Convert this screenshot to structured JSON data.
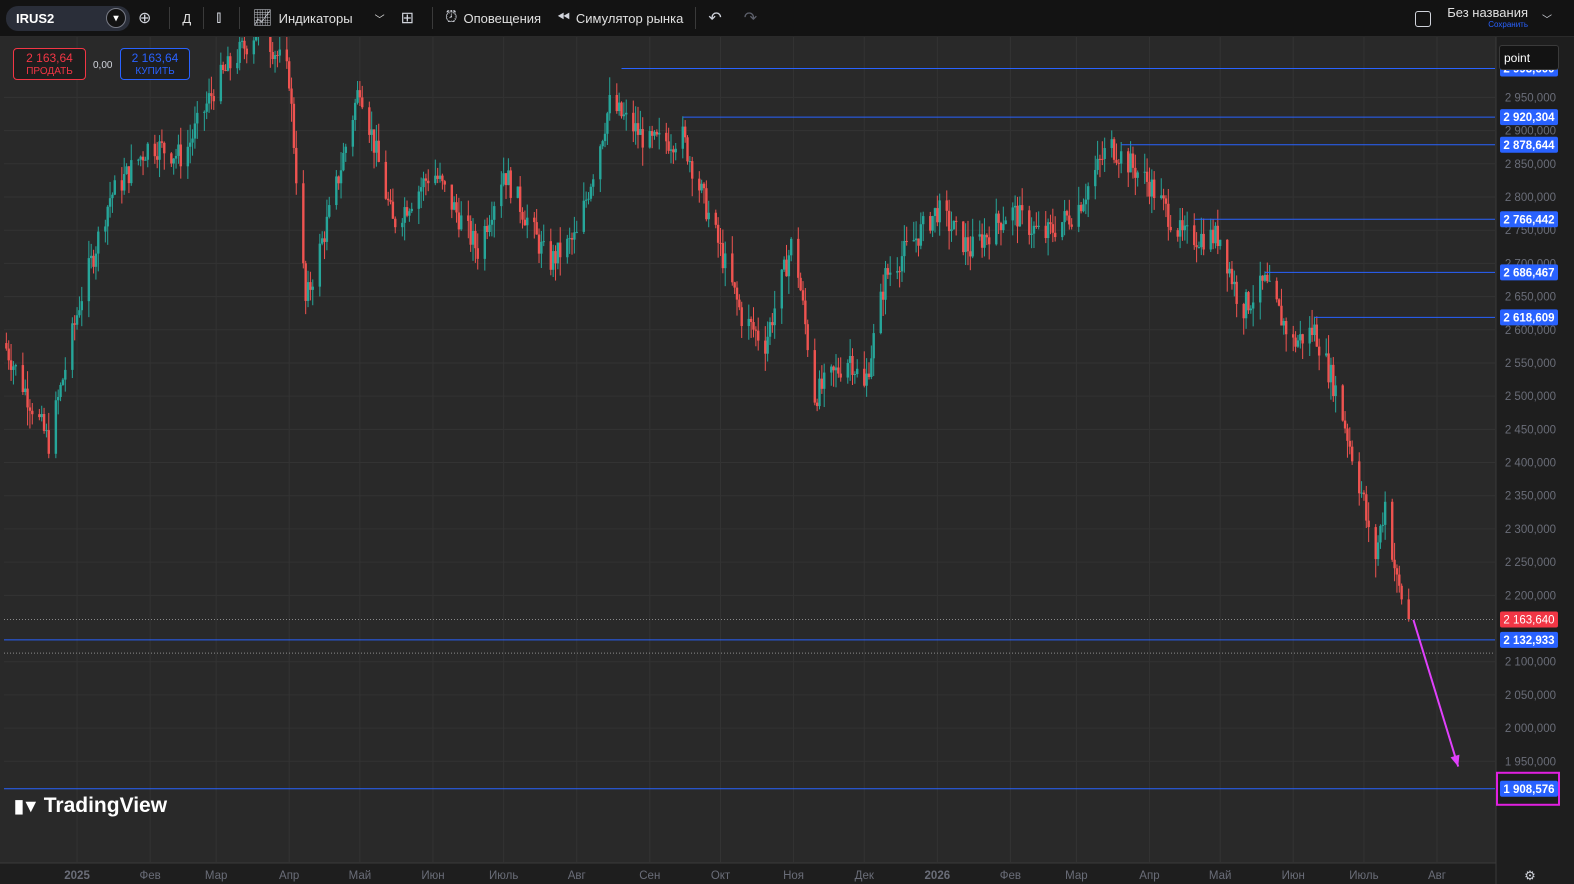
{
  "toolbar": {
    "symbol": "IRUS2",
    "interval": "Д",
    "indicators": "Индикаторы",
    "alerts": "Оповещения",
    "replay": "Симулятор рынка",
    "layout_name": "Без названия",
    "save": "Сохранить"
  },
  "trade": {
    "sell_price": "2 163,64",
    "sell_label": "ПРОДАТЬ",
    "buy_price": "2 163,64",
    "buy_label": "КУПИТЬ",
    "spread": "0,00"
  },
  "scale_input": "point",
  "watermark": "TradingView",
  "colors": {
    "background": "#292929",
    "up": "#26a69a",
    "down": "#ef5350",
    "level_line": "#2962ff",
    "arrow": "#e040fb",
    "last_price": "#f23645"
  },
  "chart_data": {
    "type": "candlestick",
    "ylim": [
      1850,
      3060
    ],
    "y_ticks": [
      "2 950,000",
      "2 900,000",
      "2 850,000",
      "2 800,000",
      "2 750,000",
      "2 700,000",
      "2 650,000",
      "2 600,000",
      "2 550,000",
      "2 500,000",
      "2 450,000",
      "2 400,000",
      "2 350,000",
      "2 300,000",
      "2 250,000",
      "2 200,000",
      "2 100,000",
      "2 050,000",
      "2 000,000",
      "1 950,000"
    ],
    "y_tick_values": [
      2950,
      2900,
      2850,
      2800,
      2750,
      2700,
      2650,
      2600,
      2550,
      2500,
      2450,
      2400,
      2350,
      2300,
      2250,
      2200,
      2100,
      2050,
      2000,
      1950
    ],
    "x_labels": [
      "2025",
      "Фев",
      "Мар",
      "Апр",
      "Май",
      "Июн",
      "Июль",
      "Авг",
      "Сен",
      "Окт",
      "Ноя",
      "Дек",
      "2026",
      "Фев",
      "Мар",
      "Апр",
      "Май",
      "Июн",
      "Июль",
      "Авг"
    ],
    "x_label_dates": [
      "2025-01-01",
      "2025-02-01",
      "2025-03-01",
      "2025-04-01",
      "2025-05-01",
      "2025-06-01",
      "2025-07-01",
      "2025-08-01",
      "2025-09-01",
      "2025-10-01",
      "2025-11-01",
      "2025-12-01",
      "2026-01-01",
      "2026-02-01",
      "2026-03-01",
      "2026-04-01",
      "2026-05-01",
      "2026-06-01",
      "2026-07-01",
      "2026-08-01"
    ],
    "x_range": [
      "2024-12-01",
      "2026-08-15"
    ],
    "price_path": [
      [
        "2024-12-01",
        2580
      ],
      [
        "2024-12-20",
        2430
      ],
      [
        "2025-01-02",
        2640
      ],
      [
        "2025-01-15",
        2800
      ],
      [
        "2025-02-01",
        2880
      ],
      [
        "2025-02-15",
        2860
      ],
      [
        "2025-03-01",
        2970
      ],
      [
        "2025-03-20",
        3060
      ],
      [
        "2025-04-01",
        2980
      ],
      [
        "2025-04-08",
        2640
      ],
      [
        "2025-04-20",
        2800
      ],
      [
        "2025-05-01",
        2970
      ],
      [
        "2025-05-15",
        2760
      ],
      [
        "2025-06-01",
        2840
      ],
      [
        "2025-06-20",
        2720
      ],
      [
        "2025-07-01",
        2840
      ],
      [
        "2025-07-20",
        2700
      ],
      [
        "2025-08-01",
        2740
      ],
      [
        "2025-08-15",
        2940
      ],
      [
        "2025-09-01",
        2880
      ],
      [
        "2025-09-15",
        2890
      ],
      [
        "2025-10-01",
        2720
      ],
      [
        "2025-10-10",
        2620
      ],
      [
        "2025-10-20",
        2580
      ],
      [
        "2025-11-01",
        2740
      ],
      [
        "2025-11-10",
        2500
      ],
      [
        "2025-11-25",
        2560
      ],
      [
        "2025-12-01",
        2510
      ],
      [
        "2025-12-10",
        2680
      ],
      [
        "2026-01-01",
        2780
      ],
      [
        "2026-01-15",
        2720
      ],
      [
        "2026-02-01",
        2780
      ],
      [
        "2026-02-15",
        2740
      ],
      [
        "2026-03-01",
        2780
      ],
      [
        "2026-03-15",
        2880
      ],
      [
        "2026-04-01",
        2820
      ],
      [
        "2026-04-15",
        2740
      ],
      [
        "2026-05-01",
        2740
      ],
      [
        "2026-05-10",
        2630
      ],
      [
        "2026-05-20",
        2670
      ],
      [
        "2026-06-01",
        2580
      ],
      [
        "2026-06-10",
        2600
      ],
      [
        "2026-06-20",
        2500
      ],
      [
        "2026-07-01",
        2340
      ],
      [
        "2026-07-05",
        2240
      ],
      [
        "2026-07-10",
        2340
      ],
      [
        "2026-07-15",
        2220
      ],
      [
        "2026-07-20",
        2163
      ]
    ],
    "levels": [
      {
        "price": 2993.6,
        "label": "2 993,600",
        "from": "2025-08-20"
      },
      {
        "price": 2920.304,
        "label": "2 920,304",
        "from": "2025-09-15"
      },
      {
        "price": 2878.644,
        "label": "2 878,644",
        "from": "2026-03-20"
      },
      {
        "price": 2766.442,
        "label": "2 766,442",
        "from": "2026-04-20"
      },
      {
        "price": 2686.467,
        "label": "2 686,467",
        "from": "2026-05-20"
      },
      {
        "price": 2618.609,
        "label": "2 618,609",
        "from": "2026-06-10"
      },
      {
        "price": 2132.933,
        "label": "2 132,933",
        "from": "2024-12-01"
      },
      {
        "price": 1908.576,
        "label": "1 908,576",
        "from": "2024-12-01",
        "highlighted": true
      }
    ],
    "last_price": {
      "price": 2163.64,
      "label": "2 163,640"
    },
    "dotted_lines": [
      2163.64,
      2113
    ],
    "arrow": {
      "from": [
        "2026-07-22",
        2163
      ],
      "to": [
        "2026-08-10",
        1942
      ]
    }
  }
}
